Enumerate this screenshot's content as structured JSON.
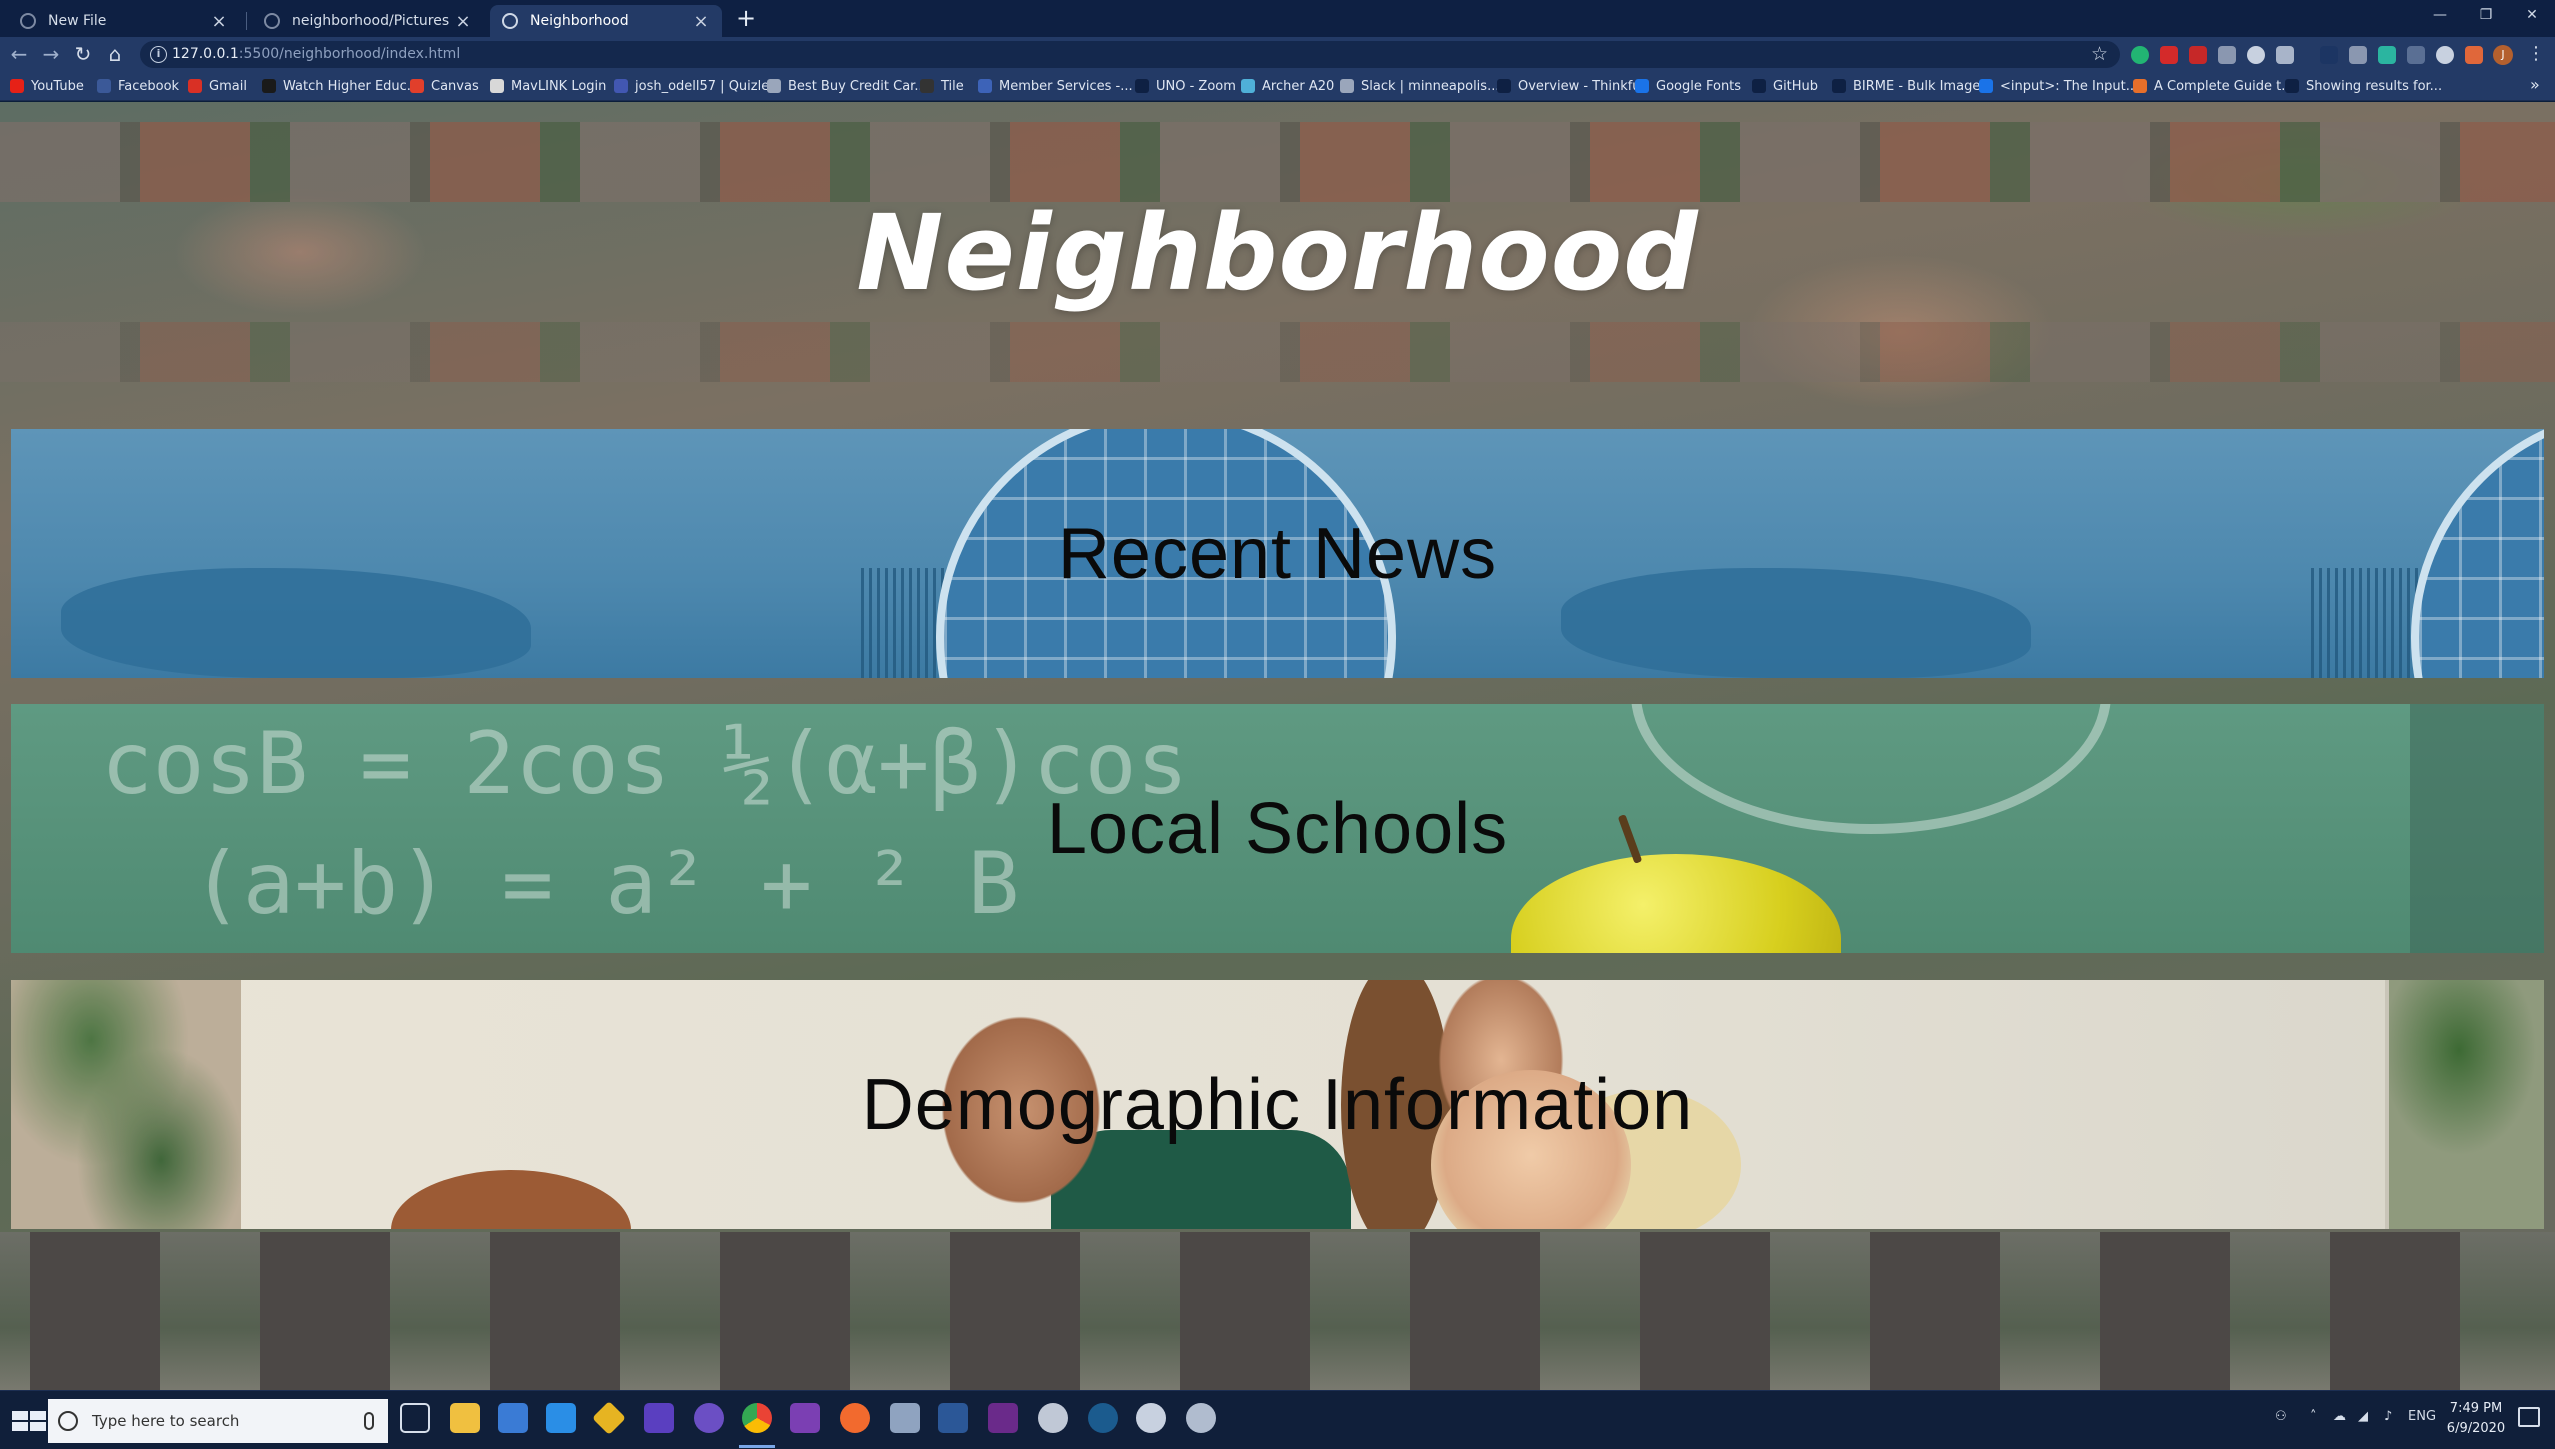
{
  "browser": {
    "tabs": [
      {
        "title": "New File",
        "active": false
      },
      {
        "title": "neighborhood/Pictures at master",
        "active": false
      },
      {
        "title": "Neighborhood",
        "active": true
      }
    ],
    "url_host": "127.0.0.1",
    "url_path": ":5500/neighborhood/index.html",
    "bookmarks": [
      {
        "label": "YouTube",
        "color": "#e62117"
      },
      {
        "label": "Facebook",
        "color": "#3b5998"
      },
      {
        "label": "Gmail",
        "color": "#d93025"
      },
      {
        "label": "Watch Higher Educ...",
        "color": "#1a1a1a"
      },
      {
        "label": "Canvas",
        "color": "#e13f2b"
      },
      {
        "label": "MavLINK Login",
        "color": "#d8d8d8"
      },
      {
        "label": "josh_odell57 | Quizlet",
        "color": "#4257b2"
      },
      {
        "label": "Best Buy Credit Car...",
        "color": "#9aa6bb"
      },
      {
        "label": "Tile",
        "color": "#333333"
      },
      {
        "label": "Member Services -...",
        "color": "#3d63b8"
      },
      {
        "label": "UNO - Zoom",
        "color": "#0e2043"
      },
      {
        "label": "Archer A20",
        "color": "#4fb0d8"
      },
      {
        "label": "Slack | minneapolis...",
        "color": "#9aa6bb"
      },
      {
        "label": "Overview - Thinkful",
        "color": "#0e2043"
      },
      {
        "label": "Google Fonts",
        "color": "#1a73e8"
      },
      {
        "label": "GitHub",
        "color": "#0e2043"
      },
      {
        "label": "BIRME - Bulk Image...",
        "color": "#0e2043"
      },
      {
        "label": "<input>: The Input...",
        "color": "#1a73e8"
      },
      {
        "label": "A Complete Guide t...",
        "color": "#e76f2a"
      },
      {
        "label": "Showing results for...",
        "color": "#0e2043"
      }
    ]
  },
  "page": {
    "title": "Neighborhood",
    "sections": [
      {
        "label": "Recent News"
      },
      {
        "label": "Local Schools"
      },
      {
        "label": "Demographic Information"
      }
    ]
  },
  "taskbar": {
    "search_placeholder": "Type here to search",
    "language": "ENG",
    "time": "7:49 PM",
    "date": "6/9/2020"
  }
}
